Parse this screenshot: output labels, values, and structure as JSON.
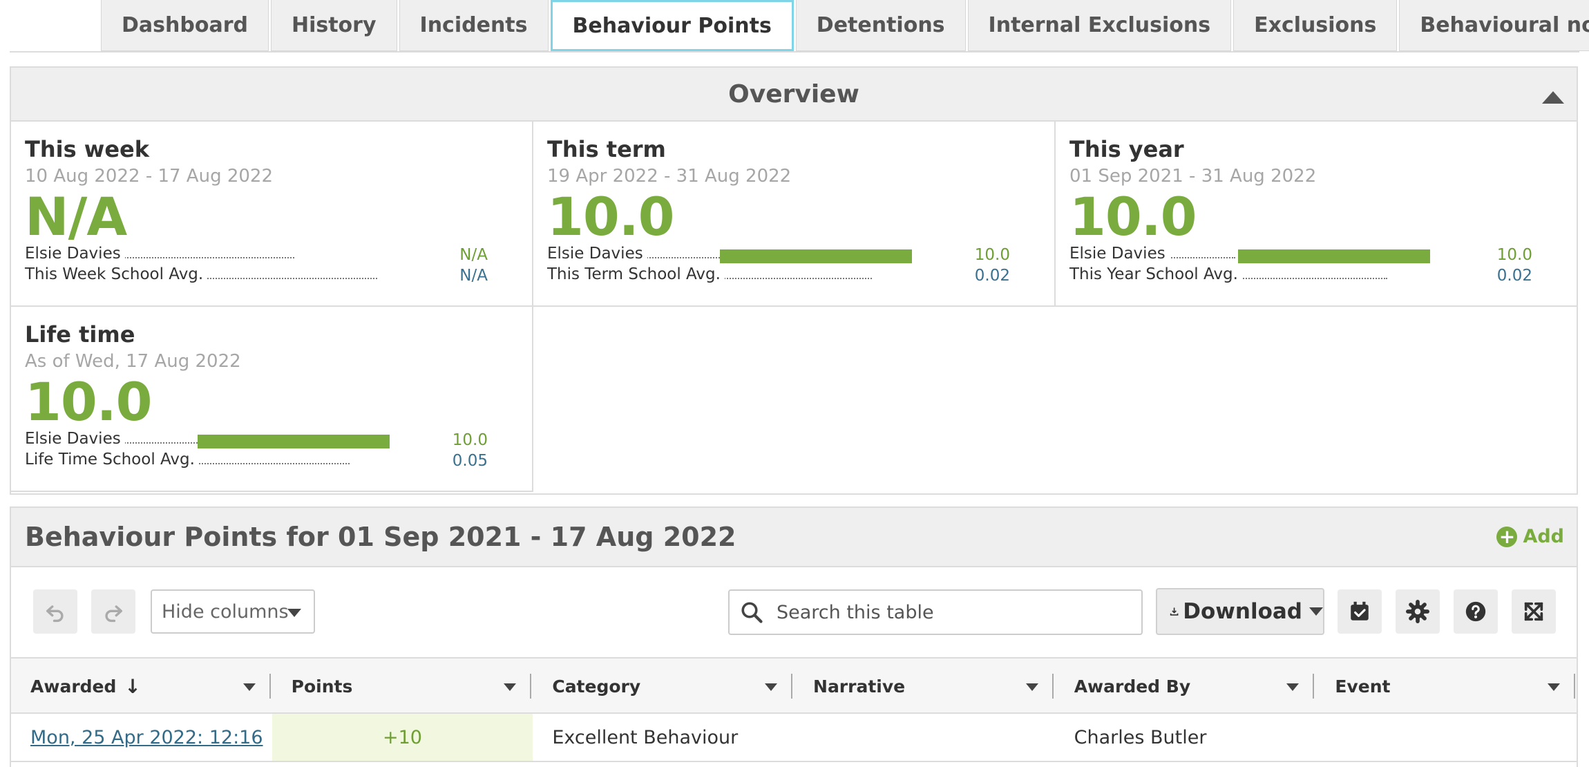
{
  "tabs": [
    {
      "label": "Dashboard"
    },
    {
      "label": "History"
    },
    {
      "label": "Incidents"
    },
    {
      "label": "Behaviour Points",
      "active": true
    },
    {
      "label": "Detentions"
    },
    {
      "label": "Internal Exclusions"
    },
    {
      "label": "Exclusions"
    },
    {
      "label": "Behavioural notes"
    }
  ],
  "overview": {
    "title": "Overview",
    "cards": [
      {
        "title": "This week",
        "range": "10 Aug 2022 - 17 Aug 2022",
        "value": "N/A",
        "student_label": "Elsie Davies",
        "student_value": "N/A",
        "student_fraction": 0,
        "avg_label": "This Week School Avg.",
        "avg_value": "N/A"
      },
      {
        "title": "This term",
        "range": "19 Apr 2022 - 31 Aug 2022",
        "value": "10.0",
        "student_label": "Elsie Davies",
        "student_value": "10.0",
        "student_fraction": 1,
        "avg_label": "This Term School Avg.",
        "avg_value": "0.02"
      },
      {
        "title": "This year",
        "range": "01 Sep 2021 - 31 Aug 2022",
        "value": "10.0",
        "student_label": "Elsie Davies",
        "student_value": "10.0",
        "student_fraction": 1,
        "avg_label": "This Year School Avg.",
        "avg_value": "0.02"
      },
      {
        "title": "Life time",
        "range": "As of Wed, 17 Aug 2022",
        "value": "10.0",
        "student_label": "Elsie Davies",
        "student_value": "10.0",
        "student_fraction": 1,
        "avg_label": "Life Time School Avg.",
        "avg_value": "0.05"
      }
    ]
  },
  "points": {
    "title": "Behaviour Points for 01 Sep 2021 - 17 Aug 2022",
    "add_label": "Add",
    "hide_columns_label": "Hide columns",
    "search_placeholder": "Search this table",
    "download_label": "Download",
    "columns": [
      {
        "label": "Awarded",
        "sorted": "desc"
      },
      {
        "label": "Points"
      },
      {
        "label": "Category"
      },
      {
        "label": "Narrative"
      },
      {
        "label": "Awarded By"
      },
      {
        "label": "Event"
      }
    ],
    "rows": [
      {
        "awarded": "Mon, 25 Apr 2022: 12:16",
        "points": "+10",
        "category": "Excellent Behaviour",
        "narrative": "",
        "awarded_by": "Charles Butler",
        "event": ""
      }
    ]
  },
  "icons": [
    "undo-icon",
    "redo-icon",
    "search-icon",
    "download-icon",
    "calendar-check-icon",
    "gear-icon",
    "help-icon",
    "fullscreen-icon",
    "plus-circle-icon",
    "collapse-up-icon"
  ],
  "colors": {
    "accent_green": "#7aab3e",
    "tab_active_border": "#7fd4e8",
    "link_blue": "#336a87",
    "avg_blue": "#3a7190"
  }
}
